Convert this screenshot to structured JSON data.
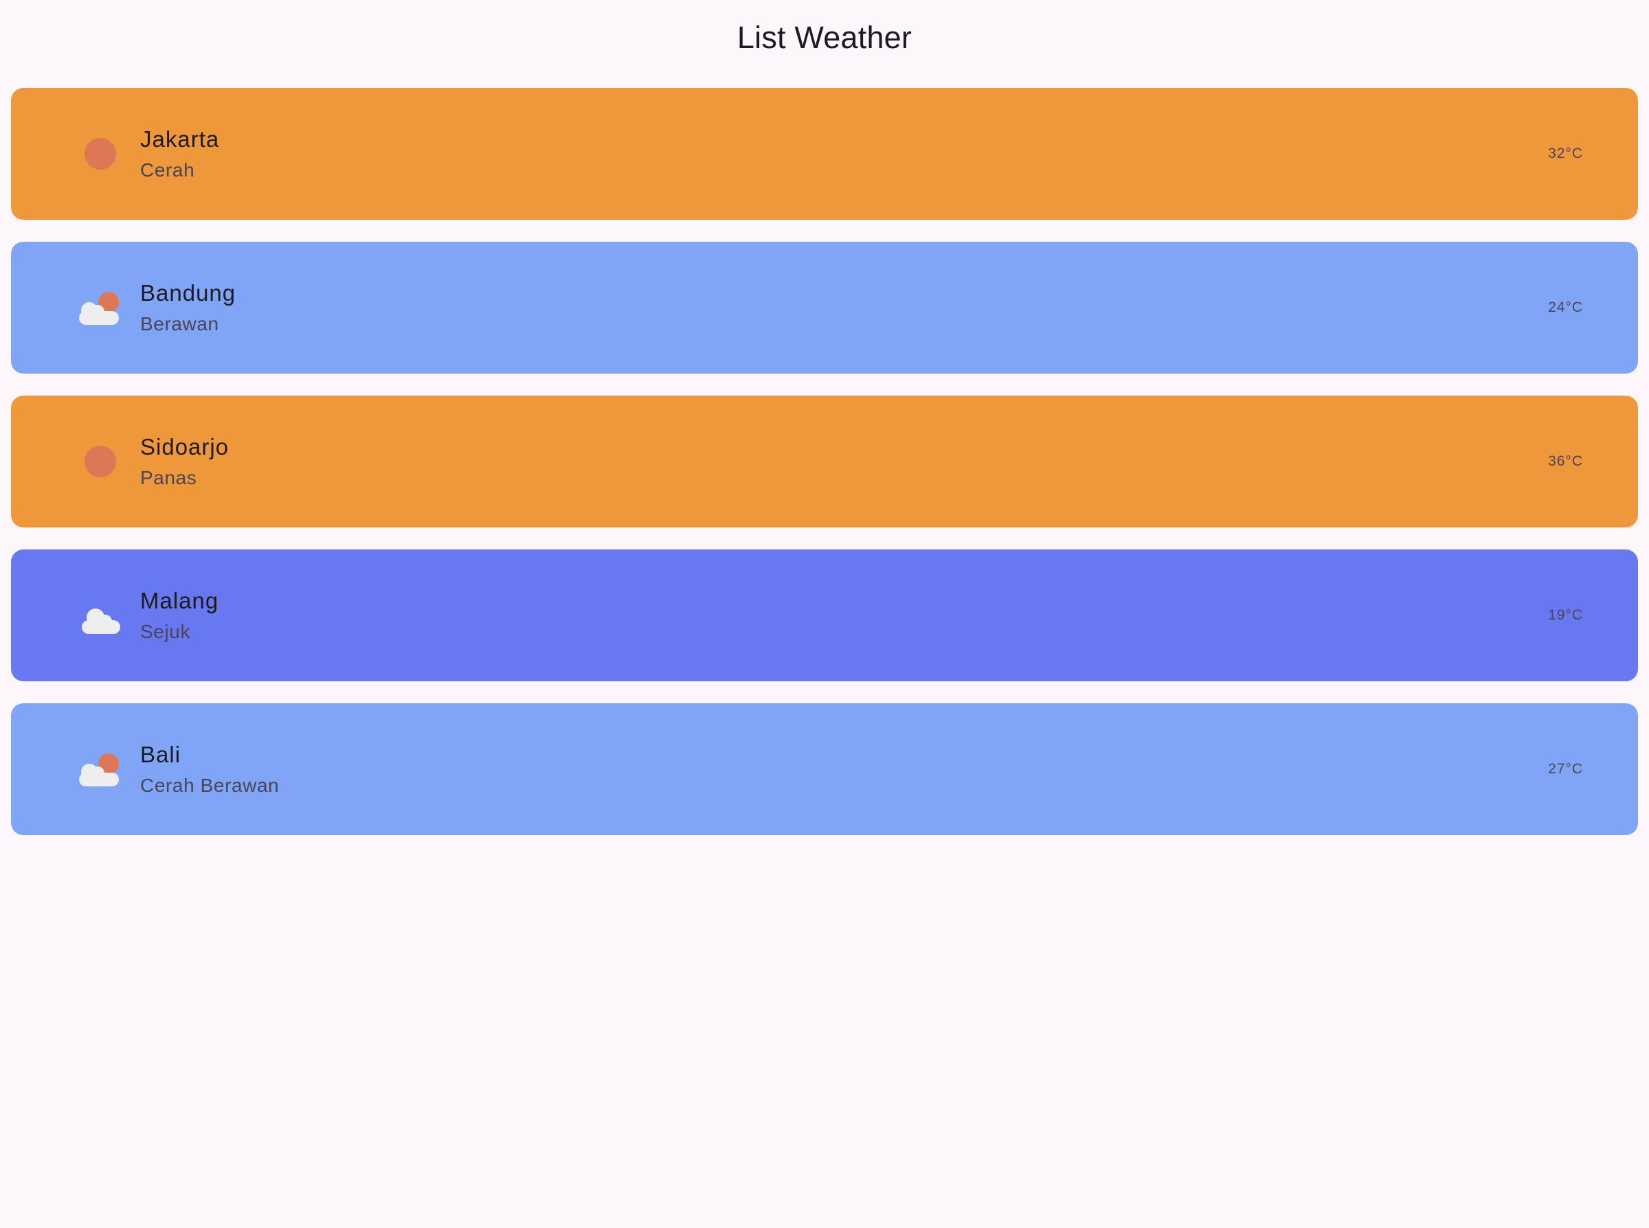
{
  "app": {
    "title": "List Weather"
  },
  "weather_list": [
    {
      "city": "Jakarta",
      "condition": "Cerah",
      "temperature": "32°C",
      "icon": "sun-icon",
      "color": "#ef983b"
    },
    {
      "city": "Bandung",
      "condition": "Berawan",
      "temperature": "24°C",
      "icon": "cloud-sun-icon",
      "color": "#80a5f7"
    },
    {
      "city": "Sidoarjo",
      "condition": "Panas",
      "temperature": "36°C",
      "icon": "sun-icon",
      "color": "#ef983b"
    },
    {
      "city": "Malang",
      "condition": "Sejuk",
      "temperature": "19°C",
      "icon": "cloud-icon",
      "color": "#6778f0"
    },
    {
      "city": "Bali",
      "condition": "Cerah Berawan",
      "temperature": "27°C",
      "icon": "cloud-sun-icon",
      "color": "#80a5f7"
    }
  ],
  "colors": {
    "background": "#fdf7fc",
    "sun": "#dd7755",
    "cloud": "#eeeeee"
  }
}
